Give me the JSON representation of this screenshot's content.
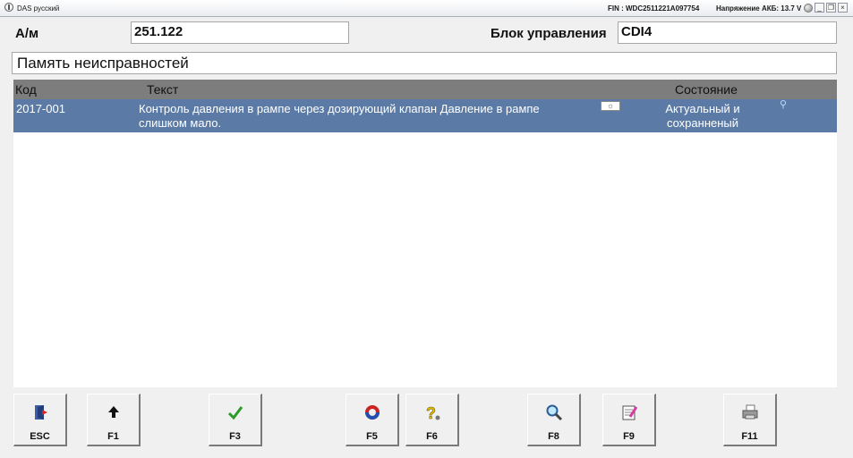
{
  "window": {
    "title": "DAS русский",
    "fin": "FIN : WDC2511221A097754",
    "battery": "Напряжение АКБ: 13.7 V",
    "controls": [
      "minimize-icon",
      "restore-icon",
      "close-icon"
    ]
  },
  "form": {
    "model_label": "А/м",
    "model_value": "251.122",
    "ecu_label": "Блок управления",
    "ecu_value": "CDI4"
  },
  "section_title": "Память неисправностей",
  "table": {
    "headers": {
      "code": "Код",
      "text": "Текст",
      "state": "Состояние"
    },
    "rows": [
      {
        "code": "2017-001",
        "text": "Контроль давления в рампе через дозирующий клапан Давление в рампе слишком мало.",
        "state": "Актуальный и сохранненый"
      }
    ]
  },
  "fkeys": [
    {
      "label": "ESC",
      "icon": "exit-door-icon"
    },
    {
      "label": "F1",
      "icon": "arrow-up-icon"
    },
    {
      "label": "F3",
      "icon": "checkmark-icon"
    },
    {
      "label": "F5",
      "icon": "refresh-icon"
    },
    {
      "label": "F6",
      "icon": "help-icon"
    },
    {
      "label": "F8",
      "icon": "magnifier-icon"
    },
    {
      "label": "F9",
      "icon": "notepad-icon"
    },
    {
      "label": "F11",
      "icon": "printer-icon"
    }
  ]
}
